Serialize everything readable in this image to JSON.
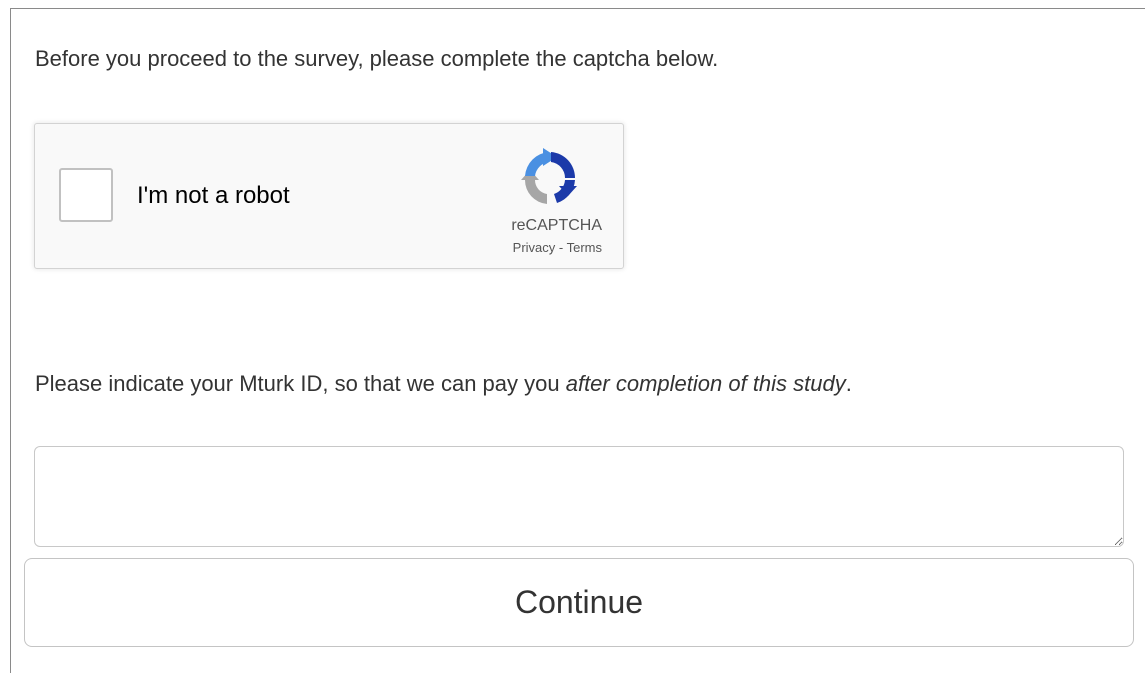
{
  "intro": {
    "text": "Before you proceed to the survey, please complete the captcha below."
  },
  "recaptcha": {
    "label": "I'm not a robot",
    "brand": "reCAPTCHA",
    "privacy_link": "Privacy",
    "separator": " - ",
    "terms_link": "Terms",
    "logo_icon": "recaptcha-logo-icon",
    "checked": false,
    "colors": {
      "logo_blue_dark": "#1c3aa9",
      "logo_blue_light": "#4a90e2",
      "logo_gray": "#a6a6a6"
    }
  },
  "question": {
    "text_before": "Please indicate your Mturk ID, so that we can pay you ",
    "text_emphasis": "after completion of this study",
    "text_after": "."
  },
  "mturk_id_field": {
    "value": "",
    "placeholder": ""
  },
  "continue_button": {
    "label": "Continue"
  }
}
